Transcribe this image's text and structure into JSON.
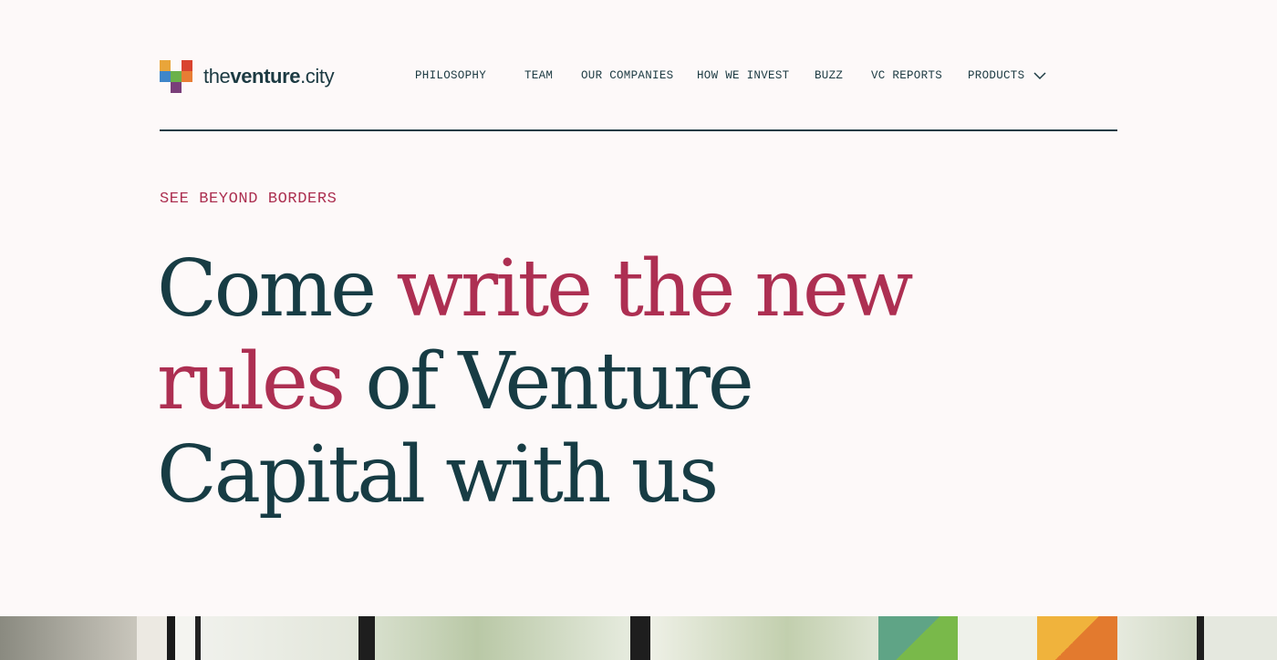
{
  "brand": {
    "name_prefix": "the",
    "name_bold": "venture",
    "name_suffix": ".city",
    "logo_colors": [
      "#e9a53a",
      "#d9432f",
      "#3f86c9",
      "#6bb14a",
      "#7a3f7a",
      "#a84a9a"
    ]
  },
  "nav": {
    "items": [
      {
        "label": "PHILOSOPHY"
      },
      {
        "label": "TEAM"
      },
      {
        "label": "OUR COMPANIES"
      },
      {
        "label": "HOW WE INVEST"
      },
      {
        "label": "BUZZ"
      },
      {
        "label": "VC REPORTS"
      },
      {
        "label": "PRODUCTS"
      }
    ],
    "products_icon": "chevron-down-icon"
  },
  "hero": {
    "eyebrow": "SEE BEYOND BORDERS",
    "line1_dark": "Come ",
    "line1_accent": "write the new",
    "line2_accent": "rules",
    "line2_dark": " of Venture",
    "line3_dark": "Capital with us"
  },
  "colors": {
    "background": "#fdf9f9",
    "text_dark": "#173c44",
    "accent": "#ad2f52"
  }
}
